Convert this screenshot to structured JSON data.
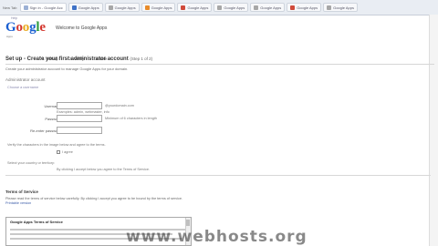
{
  "browser": {
    "pre_label": "New Tab",
    "tabs": [
      {
        "label": "Sign in - Google Acc",
        "style": "active"
      },
      {
        "label": "Google Apps",
        "style": "blue"
      },
      {
        "label": "Google Apps",
        "style": "gray"
      },
      {
        "label": "Google Apps",
        "style": "orange"
      },
      {
        "label": "Google Apps",
        "style": "red"
      },
      {
        "label": "Google Apps",
        "style": "gray"
      },
      {
        "label": "Google Apps",
        "style": "gray"
      },
      {
        "label": "Google Apps",
        "style": "red"
      },
      {
        "label": "Google Apps",
        "style": "gray"
      }
    ]
  },
  "header": {
    "logo_letters": [
      "G",
      "o",
      "o",
      "g",
      "l",
      "e"
    ],
    "logo_sub": "Apps",
    "tagline": "Welcome to Google Apps",
    "toplinks": "Help",
    "nav": [
      "1. Set up",
      "2. Verify",
      "3. Use"
    ]
  },
  "main": {
    "title": "Set up - Create your first administrator account",
    "title_sub": "(Step 1 of 2)",
    "intro": "Create your administrator account to manage Google Apps for your domain.",
    "section": "Administrator account",
    "section_sub": "Choose a username",
    "fields": {
      "username_label": "Username:",
      "username_note": "@yourdomain.com",
      "username_hint": "Examples: admin, webmaster, info",
      "password_label": "Password:",
      "password_note": "Minimum of 6 characters in length",
      "confirm_label": "Re-enter password:"
    },
    "agreement_line": "Verify the characters in the image below and agree to the terms.",
    "checkbox_label": "I agree",
    "extra_line": "Select your country or territory:",
    "extra_note": "By clicking I accept below you agree to the Terms of Service."
  },
  "terms": {
    "heading": "Terms of Service",
    "paragraph": "Please read the terms of service below carefully. By clicking I accept you agree to be bound by the terms of service.",
    "link": "Printable version",
    "box_title": "Google Apps Terms of Service"
  },
  "watermark": "www.webhosts.org"
}
